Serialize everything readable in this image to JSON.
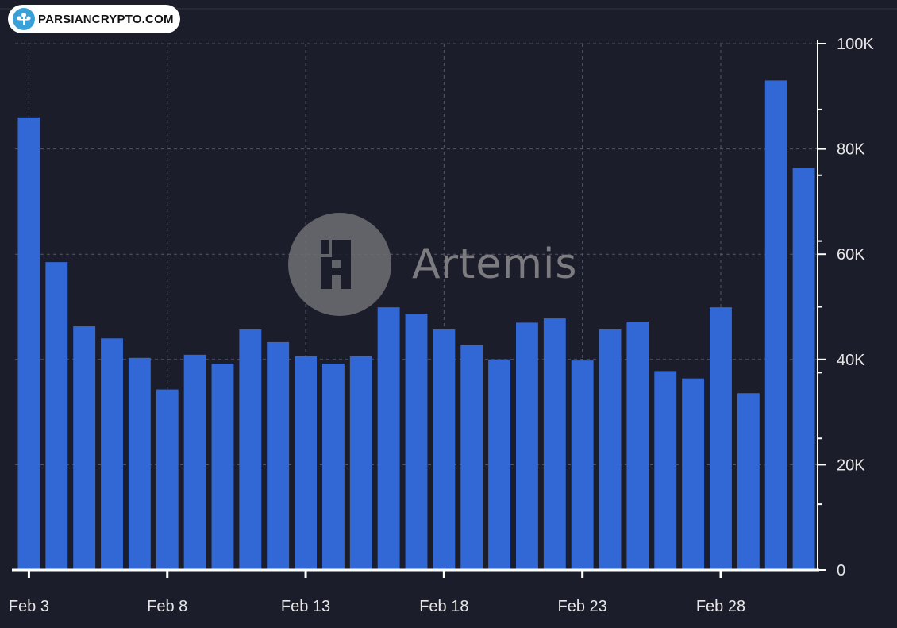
{
  "source_badge": {
    "text": "PARSIANCRYPTO.COM",
    "icon": "tree-logo-icon"
  },
  "watermark": {
    "text": "Artemis",
    "icon": "artemis-logo-icon"
  },
  "colors": {
    "background": "#1c1d2a",
    "bar": "#3168d6",
    "grid": "#555766",
    "axis": "#ffffff",
    "text": "#e6e6e6"
  },
  "chart_data": {
    "type": "bar",
    "title": "",
    "xlabel": "",
    "ylabel": "",
    "ylim": [
      0,
      100000
    ],
    "y_ticks": [
      0,
      20000,
      40000,
      60000,
      80000,
      100000
    ],
    "y_tick_labels": [
      "0",
      "20K",
      "40K",
      "60K",
      "80K",
      "100K"
    ],
    "x_tick_labels": [
      "Feb 3",
      "Feb 8",
      "Feb 13",
      "Feb 18",
      "Feb 23",
      "Feb 28"
    ],
    "x_tick_categories": [
      "Feb 3",
      "Feb 8",
      "Feb 13",
      "Feb 18",
      "Feb 23",
      "Feb 28"
    ],
    "grid": true,
    "y_axis_position": "right",
    "categories": [
      "Feb 3",
      "Feb 4",
      "Feb 5",
      "Feb 6",
      "Feb 7",
      "Feb 8",
      "Feb 9",
      "Feb 10",
      "Feb 11",
      "Feb 12",
      "Feb 13",
      "Feb 14",
      "Feb 15",
      "Feb 16",
      "Feb 17",
      "Feb 18",
      "Feb 19",
      "Feb 20",
      "Feb 21",
      "Feb 22",
      "Feb 23",
      "Feb 24",
      "Feb 25",
      "Feb 26",
      "Feb 27",
      "Feb 28",
      "Feb 29",
      "Mar 1",
      "Mar 2"
    ],
    "values": [
      86000,
      58500,
      46300,
      44000,
      40300,
      34300,
      40900,
      39200,
      45700,
      43300,
      40600,
      39200,
      40600,
      49900,
      48700,
      45700,
      42700,
      40000,
      47000,
      47800,
      39800,
      45700,
      47200,
      37800,
      36400,
      49900,
      33600,
      93000,
      76400
    ]
  }
}
